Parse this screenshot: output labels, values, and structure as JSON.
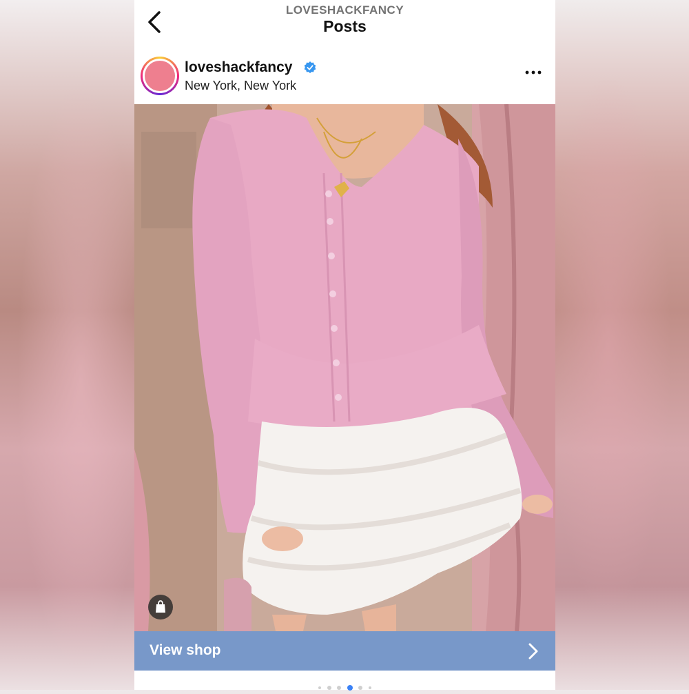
{
  "nav": {
    "account": "LOVESHACKFANCY",
    "title": "Posts"
  },
  "post": {
    "username": "loveshackfancy",
    "location": "New York, New York",
    "verified": true,
    "image_alt": "Woman in pink ribbed peplum cardigan and white tiered ruffle mini skirt"
  },
  "shop": {
    "label": "View shop"
  },
  "carousel": {
    "total": 6,
    "active_index": 3
  },
  "colors": {
    "verified": "#3897f0",
    "shop_bar": "#7898c9",
    "active_dot": "#3b82f6"
  }
}
